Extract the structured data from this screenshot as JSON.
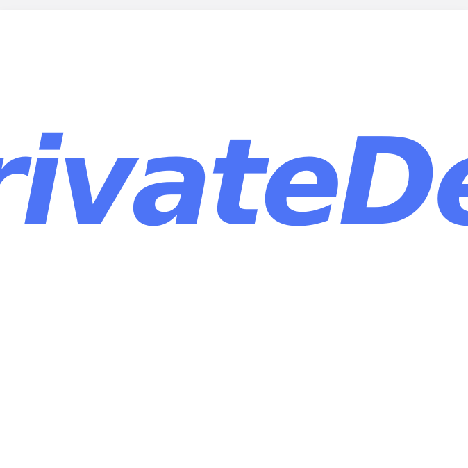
{
  "header": {
    "logo_text": "rivateDeli",
    "logo_color": "#4d74f6"
  },
  "colors": {
    "background": "#ffffff",
    "top_strip": "#f3f3f4"
  }
}
